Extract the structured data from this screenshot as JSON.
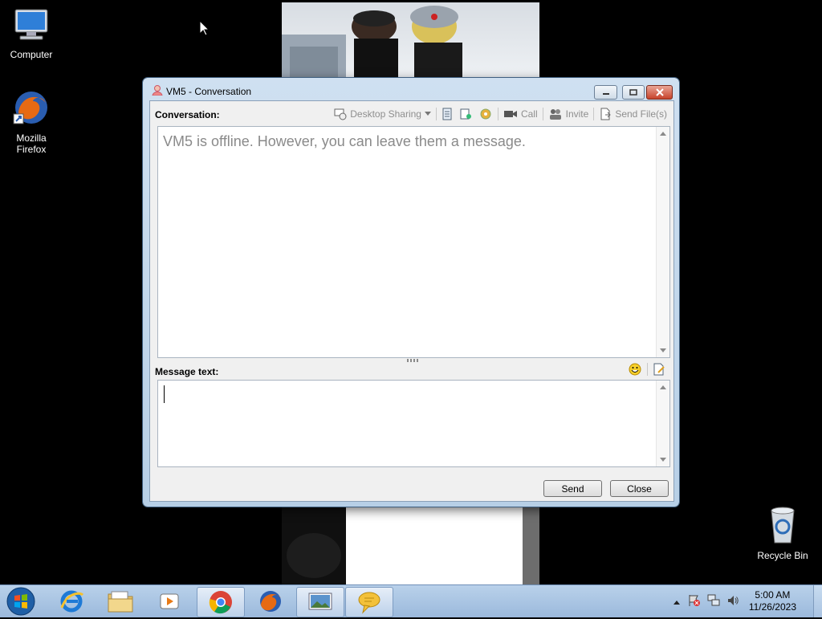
{
  "desktop": {
    "icons": [
      {
        "label": "Computer"
      },
      {
        "label": "Mozilla\nFirefox"
      },
      {
        "label": "Recycle Bin"
      }
    ]
  },
  "window": {
    "title": "VM5 - Conversation",
    "conversation_label": "Conversation:",
    "toolbar": {
      "desktop_sharing": "Desktop Sharing",
      "call": "Call",
      "invite": "Invite",
      "send_files": "Send File(s)"
    },
    "conversation_text": "VM5 is offline. However, you can leave them a message.",
    "message_label": "Message text:",
    "message_value": "",
    "send_label": "Send",
    "close_label": "Close"
  },
  "taskbar": {
    "clock_time": "5:00 AM",
    "clock_date": "11/26/2023"
  },
  "colors": {
    "title_bar": "#cfe0f1",
    "taskbar": "#b9d1ea",
    "close_button": "#c7432b"
  }
}
